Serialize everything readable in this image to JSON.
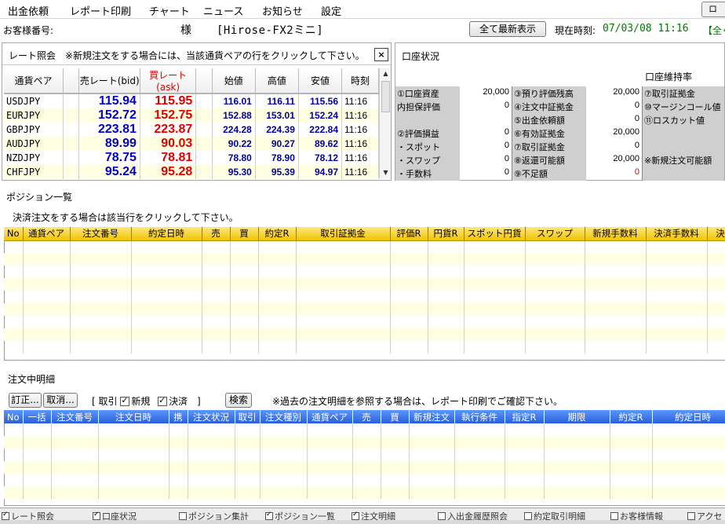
{
  "menu": {
    "items": [
      "出金依頼",
      "レポート印刷",
      "チャート",
      "ニュース",
      "お知らせ",
      "設定"
    ],
    "close_label": "ロ"
  },
  "header": {
    "customer_label": "お客様番号:",
    "sama": "様",
    "service": "[Hirose-FX2ミニ]",
    "refresh_all": "全て最新表示",
    "time_label": "現在時刻:",
    "time_value": "07/03/08 11:16",
    "time_extra": "【全ぐ"
  },
  "rate_panel": {
    "title": "レート照会",
    "note": "※新規注文をする場合には、当該通貨ペアの行をクリックして下さい。",
    "close": "×",
    "headers": [
      "通貨ペア",
      "",
      "売レート(bid)",
      "買レート(ask)",
      "",
      "始値",
      "高値",
      "安値",
      "時刻"
    ],
    "rows": [
      {
        "pair": "USDJPY",
        "bid": "115.94",
        "ask": "115.95",
        "open": "116.01",
        "high": "116.11",
        "low": "115.56",
        "time": "11:16"
      },
      {
        "pair": "EURJPY",
        "bid": "152.72",
        "ask": "152.75",
        "open": "152.88",
        "high": "153.01",
        "low": "152.24",
        "time": "11:16"
      },
      {
        "pair": "GBPJPY",
        "bid": "223.81",
        "ask": "223.87",
        "open": "224.28",
        "high": "224.39",
        "low": "222.84",
        "time": "11:16"
      },
      {
        "pair": "AUDJPY",
        "bid": "89.99",
        "ask": "90.03",
        "open": "90.22",
        "high": "90.27",
        "low": "89.62",
        "time": "11:16"
      },
      {
        "pair": "NZDJPY",
        "bid": "78.75",
        "ask": "78.81",
        "open": "78.80",
        "high": "78.90",
        "low": "78.12",
        "time": "11:16"
      },
      {
        "pair": "CHFJPY",
        "bid": "95.24",
        "ask": "95.28",
        "open": "95.30",
        "high": "95.39",
        "low": "94.97",
        "time": "11:16"
      }
    ]
  },
  "account_panel": {
    "title": "口座状況",
    "maintenance": "口座維持率",
    "col1": [
      {
        "label": "①口座資産",
        "value": "20,000"
      },
      {
        "label": "内担保評価",
        "value": "0"
      },
      {
        "label": "",
        "value": ""
      },
      {
        "label": "②評価損益",
        "value": "0"
      },
      {
        "label": "・スポット",
        "value": "0"
      },
      {
        "label": "・スワップ",
        "value": "0"
      },
      {
        "label": "・手数料",
        "value": "0"
      }
    ],
    "col2": [
      {
        "label": "③預り評価残高",
        "value": "20,000"
      },
      {
        "label": "④注文中証拠金",
        "value": "0"
      },
      {
        "label": "⑤出金依頼額",
        "value": "0"
      },
      {
        "label": "⑥有効証拠金",
        "value": "20,000"
      },
      {
        "label": "⑦取引証拠金",
        "value": "0"
      },
      {
        "label": "⑧返還可能額",
        "value": "20,000"
      },
      {
        "label": "⑨不足額",
        "value": "0"
      }
    ],
    "col3": [
      {
        "label": "⑦取引証拠金",
        "value": ""
      },
      {
        "label": "⑩マージンコール値",
        "value": ""
      },
      {
        "label": "⑪ロスカット値",
        "value": ""
      },
      {
        "label": "",
        "value": ""
      },
      {
        "label": "",
        "value": ""
      },
      {
        "label": "※新規注文可能額",
        "value": ""
      },
      {
        "label": "",
        "value": ""
      }
    ]
  },
  "positions": {
    "title": "ポジション一覧",
    "note": "決済注文をする場合は該当行をクリックして下さい。",
    "headers": [
      "No",
      "通貨ペア",
      "注文番号",
      "約定日時",
      "売",
      "買",
      "約定R",
      "取引証拠金",
      "評価R",
      "円貨R",
      "スポット円貨",
      "スワップ",
      "新規手数料",
      "決済手数料",
      "決"
    ]
  },
  "orders": {
    "title": "注文中明細",
    "edit_button": "訂正...",
    "cancel_button": "取消...",
    "filter_prefix": "[ 取引",
    "filter_new": "新規",
    "filter_settle": "決済",
    "filter_suffix": "]",
    "search_button": "検索",
    "note": "※過去の注文明細を参照する場合は、レポート印刷でご確認下さい。",
    "headers": [
      "No",
      "一括",
      "注文番号",
      "注文日時",
      "携",
      "注文状況",
      "取引",
      "注文種別",
      "通貨ペア",
      "売",
      "買",
      "新規注文",
      "執行条件",
      "指定R",
      "期限",
      "約定R",
      "約定日時"
    ]
  },
  "bottom_tabs": [
    {
      "label": "レート照会",
      "checked": true
    },
    {
      "label": "口座状況",
      "checked": true
    },
    {
      "label": "ポジション集計",
      "checked": false
    },
    {
      "label": "ポジション一覧",
      "checked": true
    },
    {
      "label": "注文明細",
      "checked": true
    },
    {
      "label": "入出金履歴照会",
      "checked": false
    },
    {
      "label": "約定取引明細",
      "checked": false
    },
    {
      "label": "お客様情報",
      "checked": false
    },
    {
      "label": "アクセ",
      "checked": false
    }
  ],
  "colors": {
    "bid": "#0000c8",
    "ask": "#e00000",
    "time_green": "#007a00",
    "row_alt": "#ffffe2",
    "pos_header": "#f2c400",
    "ord_header": "#2a5fd8"
  }
}
